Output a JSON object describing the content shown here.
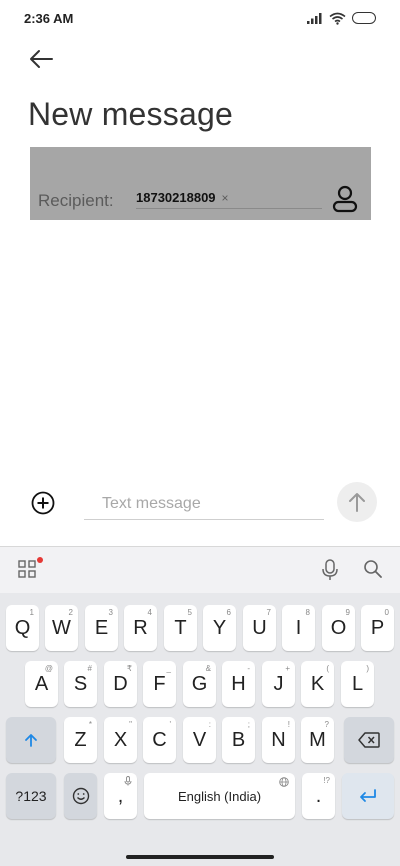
{
  "status_bar": {
    "time": "2:36 AM"
  },
  "page": {
    "title": "New message"
  },
  "recipient": {
    "label": "Recipient:",
    "chip_number": "18730218809",
    "chip_remove": "×"
  },
  "compose": {
    "placeholder": "Text message"
  },
  "keyboard": {
    "row1": [
      {
        "label": "Q",
        "hint": "1"
      },
      {
        "label": "W",
        "hint": "2"
      },
      {
        "label": "E",
        "hint": "3"
      },
      {
        "label": "R",
        "hint": "4"
      },
      {
        "label": "T",
        "hint": "5"
      },
      {
        "label": "Y",
        "hint": "6"
      },
      {
        "label": "U",
        "hint": "7"
      },
      {
        "label": "I",
        "hint": "8"
      },
      {
        "label": "O",
        "hint": "9"
      },
      {
        "label": "P",
        "hint": "0"
      }
    ],
    "row2": [
      {
        "label": "A",
        "hint": "@"
      },
      {
        "label": "S",
        "hint": "#"
      },
      {
        "label": "D",
        "hint": "₹"
      },
      {
        "label": "F",
        "hint": "_"
      },
      {
        "label": "G",
        "hint": "&"
      },
      {
        "label": "H",
        "hint": "-"
      },
      {
        "label": "J",
        "hint": "+"
      },
      {
        "label": "K",
        "hint": "("
      },
      {
        "label": "L",
        "hint": ")"
      }
    ],
    "row3": [
      {
        "label": "Z",
        "hint": "*"
      },
      {
        "label": "X",
        "hint": "\""
      },
      {
        "label": "C",
        "hint": "'"
      },
      {
        "label": "V",
        "hint": ":"
      },
      {
        "label": "B",
        "hint": ";"
      },
      {
        "label": "N",
        "hint": "!"
      },
      {
        "label": "M",
        "hint": "?"
      }
    ],
    "symbols_label": "?123",
    "comma_label": ",",
    "space_label": "English (India)",
    "period_label": ".",
    "period_hint": "!?"
  },
  "colors": {
    "accent": "#1e88e5",
    "recipient_overlay": "#a6a6a6",
    "badge_dot": "#e53935"
  },
  "icons": [
    "back-arrow-icon",
    "contact-icon",
    "add-circle-icon",
    "send-arrow-icon",
    "apps-grid-icon",
    "mic-icon",
    "search-icon",
    "shift-icon",
    "backspace-icon",
    "emoji-icon",
    "globe-icon",
    "enter-icon",
    "signal-icon",
    "wifi-icon",
    "battery-icon"
  ]
}
